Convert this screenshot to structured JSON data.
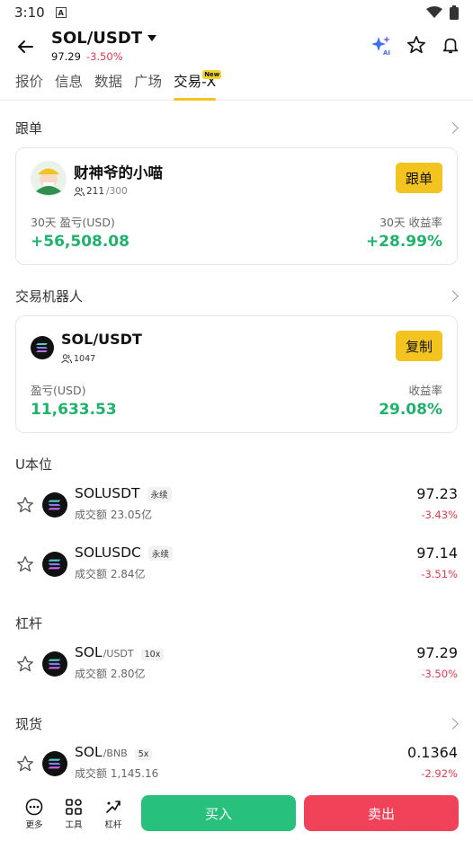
{
  "status_bar": {
    "time": "3:10",
    "badge": "A"
  },
  "header": {
    "pair": "SOL/USDT",
    "price": "97.29",
    "change": "-3.50%"
  },
  "tabs": [
    {
      "label": "报价"
    },
    {
      "label": "信息"
    },
    {
      "label": "数据"
    },
    {
      "label": "广场"
    },
    {
      "label": "交易-X",
      "badge": "New"
    }
  ],
  "copy_trading": {
    "section": "跟单",
    "trader_name": "财神爷的小喵",
    "followers": "211",
    "followers_max": "/300",
    "button": "跟单",
    "pnl_label": "30天 盈亏(USD)",
    "pnl_value": "+56,508.08",
    "roi_label": "30天 收益率",
    "roi_value": "+28.99%"
  },
  "bot": {
    "section": "交易机器人",
    "name": "SOL/USDT",
    "users": "1047",
    "button": "复制",
    "pnl_label": "盈亏(USD)",
    "pnl_value": "11,633.53",
    "roi_label": "收益率",
    "roi_value": "29.08%"
  },
  "sections": {
    "u_margin": "U本位",
    "margin": "杠杆",
    "spot": "现货"
  },
  "rows": [
    {
      "base": "SOLUSDT",
      "quote": "",
      "tag": "永续",
      "volume": "成交额 23.05亿",
      "price": "97.23",
      "change": "-3.43%"
    },
    {
      "base": "SOLUSDC",
      "quote": "",
      "tag": "永续",
      "volume": "成交额 2.84亿",
      "price": "97.14",
      "change": "-3.51%"
    },
    {
      "base": "SOL",
      "quote": "/USDT",
      "tag": "10x",
      "volume": "成交额 2.80亿",
      "price": "97.29",
      "change": "-3.50%"
    },
    {
      "base": "SOL",
      "quote": "/BNB",
      "tag": "5x",
      "volume": "成交额 1,145.16",
      "price": "0.1364",
      "change": "-2.92%"
    }
  ],
  "bottom": {
    "more": "更多",
    "tools": "工具",
    "leverage": "杠杆",
    "buy": "买入",
    "sell": "卖出"
  },
  "colors": {
    "up": "#20b26c",
    "down": "#e8394d",
    "accent": "#f3c420"
  }
}
